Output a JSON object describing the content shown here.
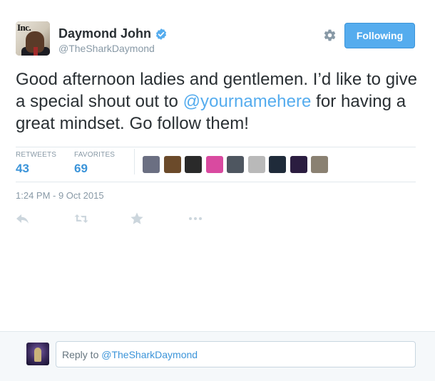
{
  "tweet": {
    "author": {
      "name": "Daymond John",
      "handle": "@TheSharkDaymond",
      "verified": true,
      "avatar_text": "Inc."
    },
    "follow_button_label": "Following",
    "text": {
      "part1": "Good afternoon ladies and gentlemen. I’d like to give a special shout out to ",
      "mention": "@yournamehere",
      "part2": " for having a great mindset. Go follow them!"
    },
    "stats": {
      "retweets_label": "RETWEETS",
      "retweets_count": "43",
      "favorites_label": "FAVORITES",
      "favorites_count": "69"
    },
    "favoriters": [
      {
        "name": "favoriter-1",
        "color": "#6b6f82"
      },
      {
        "name": "favoriter-2",
        "color": "#6b4a2a"
      },
      {
        "name": "favoriter-3",
        "color": "#2a2a2a"
      },
      {
        "name": "favoriter-4",
        "color": "#d94aa0"
      },
      {
        "name": "favoriter-5",
        "color": "#4e5660"
      },
      {
        "name": "favoriter-6",
        "color": "#b9b9b9"
      },
      {
        "name": "favoriter-7",
        "color": "#1f2b3a"
      },
      {
        "name": "favoriter-8",
        "color": "#2b1d40"
      },
      {
        "name": "favoriter-9",
        "color": "#8a8172"
      }
    ],
    "timestamp": "1:24 PM - 9 Oct 2015",
    "actions": [
      "reply",
      "retweet",
      "favorite",
      "more"
    ]
  },
  "reply": {
    "prefix": "Reply to ",
    "mention": "@TheSharkDaymond"
  },
  "colors": {
    "accent": "#55acee",
    "link": "#3b94d9",
    "muted": "#8899a6",
    "text": "#292f33",
    "border": "#e1e8ed"
  }
}
